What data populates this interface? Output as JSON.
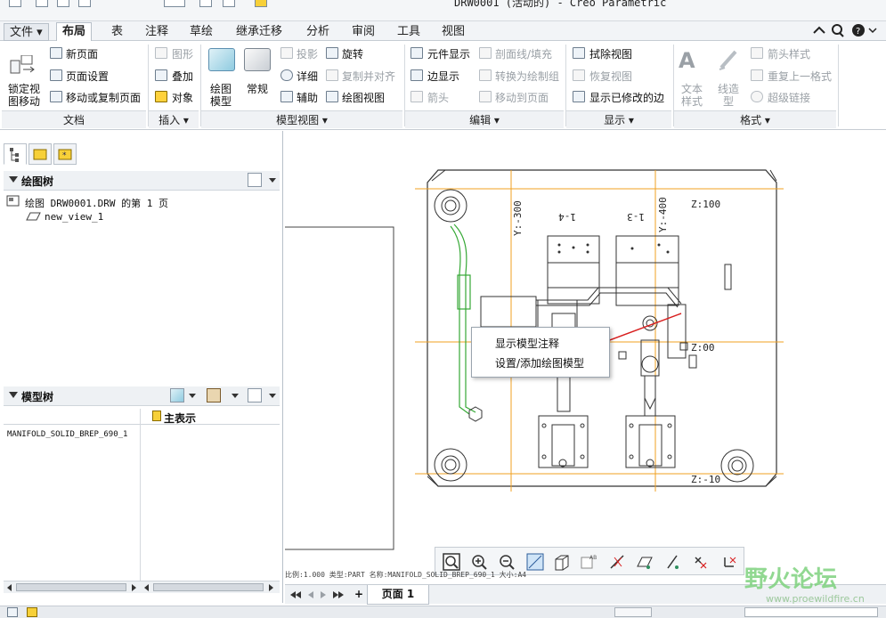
{
  "window": {
    "title": "DRW0001 (活动的) - Creo Parametric"
  },
  "menu": {
    "tabs": [
      "文件 ▾",
      "布局",
      "表",
      "注释",
      "草绘",
      "继承迁移",
      "分析",
      "审阅",
      "工具",
      "视图"
    ],
    "active_tab": "布局"
  },
  "ribbon": {
    "document": {
      "label": "文档",
      "lock_view": [
        "锁定视",
        "图移动"
      ],
      "new_page": "新页面",
      "page_setup": "页面设置",
      "move_copy_page": "移动或复制页面"
    },
    "insert": {
      "label": "插入 ▾",
      "graphic": "图形",
      "overlay": "叠加",
      "object": "对象"
    },
    "model_views": {
      "label": "模型视图 ▾",
      "drawing_model": [
        "绘图",
        "模型"
      ],
      "general": "常规",
      "projection": "投影",
      "detail": "详细",
      "auxiliary": "辅助",
      "revolve": "旋转",
      "copy_align": "复制并对齐",
      "drawing_view": "绘图视图"
    },
    "edit": {
      "label": "编辑 ▾",
      "element_display": "元件显示",
      "edge_display": "边显示",
      "arrow": "箭头",
      "section_fill": "剖面线/填充",
      "convert_to_draw_group": "转换为绘制组",
      "move_to_page": "移动到页面"
    },
    "display": {
      "label": "显示 ▾",
      "erase_view": "拭除视图",
      "restore_view": "恢复视图",
      "show_modified_edges": "显示已修改的边"
    },
    "format": {
      "label": "格式 ▾",
      "text_style": [
        "文本",
        "样式"
      ],
      "line_style": [
        "线造",
        "型"
      ],
      "arrow_style": "箭头样式",
      "repeat_format": "重复上一格式",
      "hyperlink": "超级链接"
    }
  },
  "drawing_tree": {
    "title": "绘图树",
    "page_item": "绘图 DRW0001.DRW 的第 1 页",
    "view_item": "new_view_1"
  },
  "model_tree": {
    "title": "模型树",
    "column_header": "主表示",
    "model_item": "MANIFOLD_SOLID_BREP_690_1"
  },
  "drawing": {
    "labels": {
      "y300": "Y:-300",
      "y400": "Y:-400",
      "z100": "Z:100",
      "z0": "Z:00",
      "z10": "Z:-10",
      "part_a": "1-4",
      "part_b": "1-3"
    },
    "status_line": "比例:1.000   类型:PART   名称:MANIFOLD_SOLID_BREP_690_1   大小:A4"
  },
  "context_menu": {
    "items": [
      "显示模型注释",
      "设置/添加绘图模型"
    ]
  },
  "page_tab": {
    "label": "页面 1",
    "add": "+"
  },
  "watermark": {
    "text": "野火论坛",
    "url": "www.proewildfire.cn"
  },
  "colors": {
    "accent": "#2e7cb8",
    "orange_guide": "#f0a020",
    "green_curve": "#35a835",
    "red_arrow": "#d81e1e"
  }
}
